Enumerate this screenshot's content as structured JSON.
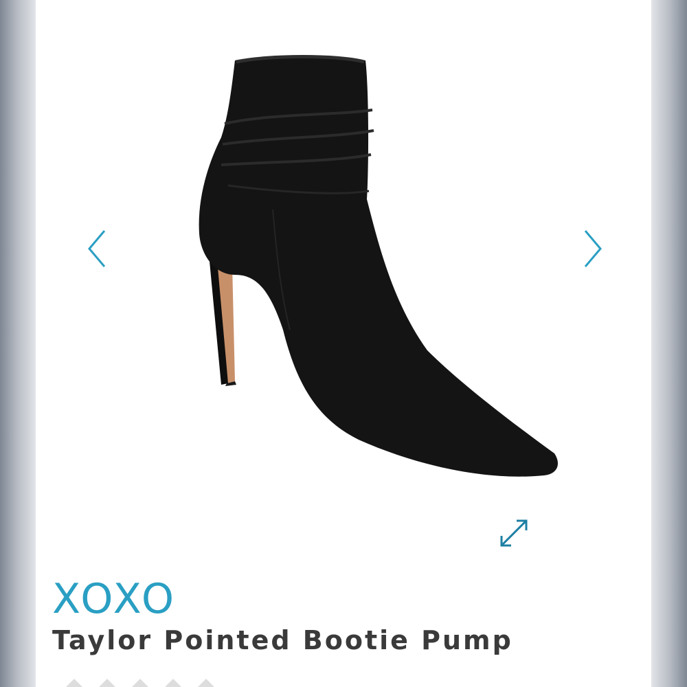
{
  "product": {
    "brand": "XOXO",
    "name": "Taylor Pointed Bootie Pump",
    "image": "black-suede-pointed-ankle-bootie"
  },
  "gallery": {
    "prev_icon": "chevron-left-icon",
    "next_icon": "chevron-right-icon",
    "expand_icon": "expand-arrows-icon"
  },
  "rating": {
    "stars_shown": 5
  },
  "colors": {
    "accent": "#2a9fc3",
    "text": "#3a3a3a",
    "boot": "#141414",
    "heel": "#c89069"
  }
}
